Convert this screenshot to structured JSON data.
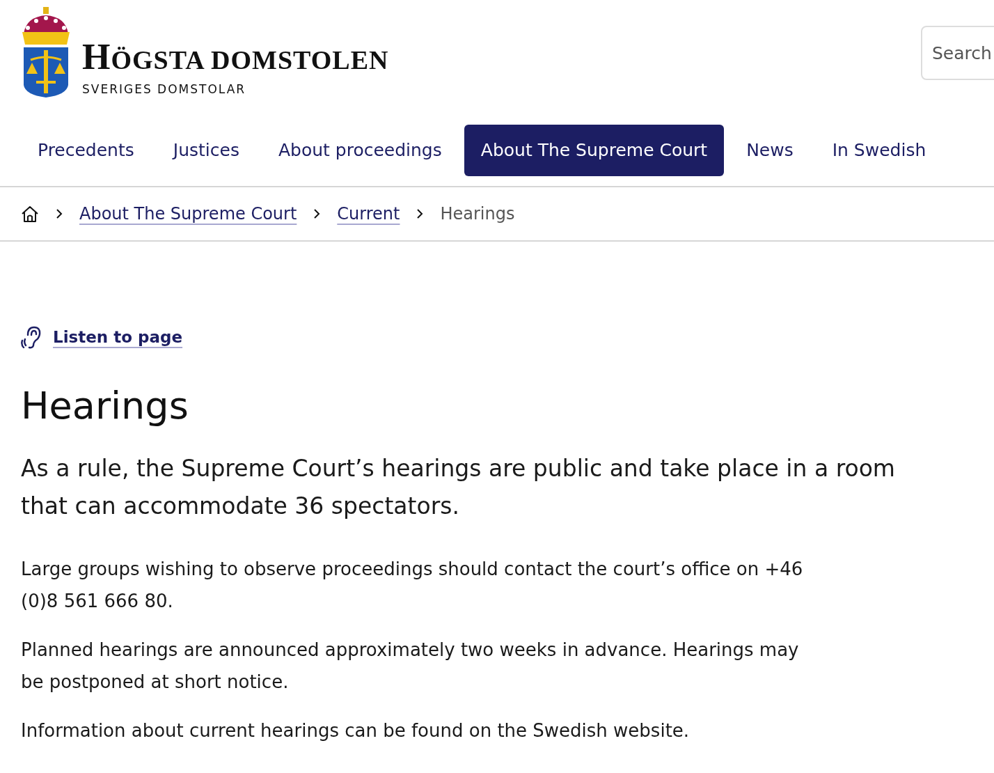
{
  "header": {
    "logo_title": "HÖGSTA DOMSTOLEN",
    "logo_subtitle": "SVERIGES DOMSTOLAR",
    "search": {
      "placeholder": "Search"
    }
  },
  "nav": [
    {
      "label": "Precedents",
      "selected": false
    },
    {
      "label": "Justices",
      "selected": false
    },
    {
      "label": "About proceedings",
      "selected": false
    },
    {
      "label": "About The Supreme Court",
      "selected": true
    },
    {
      "label": "News",
      "selected": false
    },
    {
      "label": "In Swedish",
      "selected": false
    }
  ],
  "breadcrumb": [
    {
      "label": "About The Supreme Court",
      "kind": "link"
    },
    {
      "label": "Current",
      "kind": "link"
    },
    {
      "label": "Hearings",
      "kind": "current"
    }
  ],
  "listen_link": "Listen to page",
  "title": "Hearings",
  "lead": "As a rule, the Supreme Court’s hearings are public and take place in a room that can accommodate 36 spectators.",
  "paragraphs": [
    "Large groups wishing to observe proceedings should contact the court’s office on +46 (0)8 561 666 80.",
    "Planned hearings are announced approximately two weeks in advance. Hearings may be postponed at short notice.",
    "Information about current hearings can be found on the Swedish website."
  ]
}
